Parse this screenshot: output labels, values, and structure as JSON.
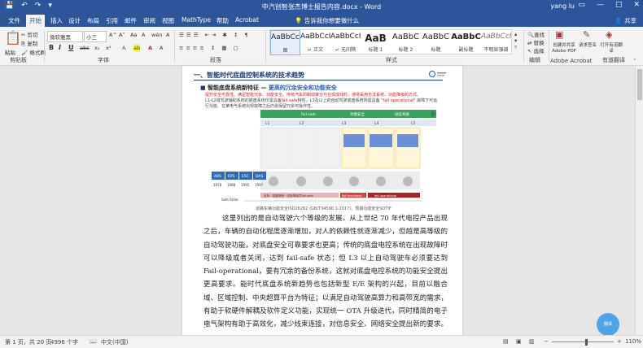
{
  "titlebar": {
    "title": "中汽创智张杰博士报告内容.docx  -  Word",
    "user": "yang lu",
    "save_icon": "💾",
    "undo_icon": "↶",
    "redo_icon": "↷",
    "customize_icon": "▾",
    "restore_icon": "▭",
    "minimize_icon": "—",
    "maximize_icon": "□",
    "close_icon": "✕"
  },
  "tabs": [
    "文件",
    "开始",
    "插入",
    "设计",
    "布局",
    "引用",
    "邮件",
    "审阅",
    "视图",
    "MathType",
    "帮助",
    "Acrobat"
  ],
  "active_tab": 1,
  "tell_me": "告诉我你想要做什么",
  "share": "共享",
  "ribbon": {
    "clipboard": {
      "paste": "粘贴",
      "cut": "剪切",
      "copy": "复制",
      "format_painter": "格式刷",
      "label": "剪贴板"
    },
    "font": {
      "family": "微软雅黑",
      "size": "小三",
      "label": "字体",
      "bold": "B",
      "italic": "I",
      "underline": "U",
      "strike": "abc",
      "sub": "x₂",
      "sup": "x²",
      "grow": "A^",
      "shrink": "A˅",
      "case": "Aa",
      "clear": "A",
      "pinyin": "wén",
      "border": "A",
      "color": "A"
    },
    "paragraph": {
      "label": "段落"
    },
    "styles": {
      "label": "样式",
      "items": [
        {
          "preview": "AaBbCcI",
          "name": "图"
        },
        {
          "preview": "AaBbCcI",
          "name": "↵ 正文"
        },
        {
          "preview": "AaBbCcI",
          "name": "↵ 无间隔"
        },
        {
          "preview": "AaB",
          "name": "标题 1"
        },
        {
          "preview": "AaBbC",
          "name": "标题 2"
        },
        {
          "preview": "AaBbC",
          "name": "标题"
        },
        {
          "preview": "AaBbC",
          "name": "副标题"
        },
        {
          "preview": "AaBbCcI",
          "name": "不明显强调"
        }
      ]
    },
    "editing": {
      "find": "查找",
      "replace": "替换",
      "select": "选择",
      "label": "编辑"
    },
    "acrobat": {
      "create_share": "创建并共享 Adobe PDF",
      "request_sign": "请求签名",
      "open_translate": "打开有道翻译",
      "label": "Adobe Acrobat",
      "label2": "有道翻译"
    }
  },
  "figure": {
    "heading": "一、智能时代底盘控制系统的技术趋势",
    "subheading_a": "智能底盘系统新特征 — ",
    "subheading_b": "更高的冗余安全和功能安全",
    "text_a": "提升安全可靠性、满足智能冗余、功能安全。传统汽车的制动审分与在现成线时，通常采用无法系统、功能降级的方式。",
    "text_b": "L1-L2级驾驶辅助系统的底盘系统仅需具备",
    "text_red_1": "fail-safe",
    "text_c": "特性，L3及以上的自动驾驶底盘系统则需具备 ",
    "text_red_2": "\"fail operational\"",
    "text_d": " 故障下可运行功能、在某电气系统出现故障之后仍需保留冗余可操作性。",
    "caption": "道路车辆功能安全ISO26262 (GB/T34590.1-2017)、预期功能安全SOTIF",
    "left_tags": [
      "ABS",
      "EPS",
      "ESC",
      "DAS"
    ],
    "years": [
      "1978",
      "1988",
      "1995",
      "1997"
    ],
    "stage_labels": [
      "L1",
      "L2",
      "L3",
      "L4",
      "L5"
    ],
    "safe_state": "Safe State",
    "bar_labels": [
      "目标：规避驾驶 · 切换驾驶员fail-safe",
      "fail functional",
      "fail operational"
    ],
    "top_labels": [
      "fail-safe",
      "功能安全",
      "动态驾驶"
    ]
  },
  "body_text": "        这里列出的是自动驾驶六个等级的发展。从上世纪 70 年代电控产品出现之后，车辆的自动化程度逐渐增加，对人的依赖性就逐渐减少，但越是高等级的自动驾驶功能，对底盘安全可靠要求也更高；传统的底盘电控系统在出现故障时可以降级或者关闭，达到 fail-safe 状态；但 L3 以上自动驾驶车必须要达到 Fail-operational，要有冗余的备份系统，这就对底盘电控系统的功能安全提出更高要求。能时代底盘系统新趋势也包括新型 E/E 架构的兴起，目前以融合域、区域控制、中央超算平台为特征；以满足自动驾驶高算力和高带宽的需求，有助于软硬件解耦及软件定义功能，实现统一 OTA 升级迭代，同时精简的电子电气架构有助于高效化，减少线束连接，对信息安全、网络安全提出新的要求。↵",
  "badge": "翻译",
  "statusbar": {
    "page": "第 1 页，共 20 页",
    "words": "4996 个字",
    "lang": "中文(中国)",
    "zoom": "110%",
    "zoom_level": 0.55,
    "minus": "−",
    "plus": "+"
  },
  "colors": {
    "word_blue": "#2b579a",
    "accent_blue": "#1f5bc2",
    "red": "#c8202a",
    "green": "#3aa35b"
  }
}
